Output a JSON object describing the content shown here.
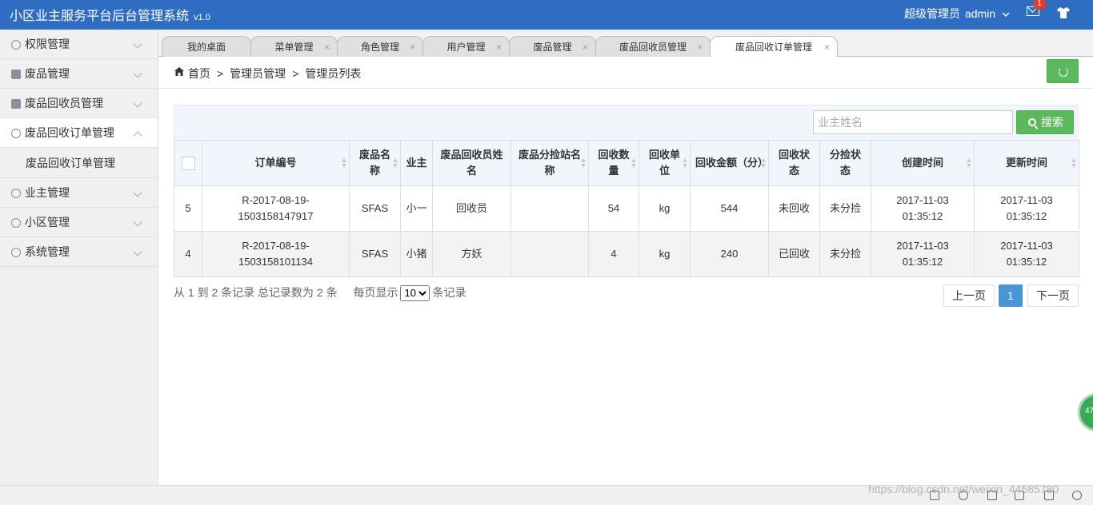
{
  "header": {
    "title": "小区业主服务平台后台管理系统",
    "version": "v1.0",
    "role": "超级管理员",
    "username": "admin",
    "mail_badge": "1"
  },
  "sidebar": {
    "items": [
      {
        "label": "权限管理"
      },
      {
        "label": "废品管理"
      },
      {
        "label": "废品回收员管理"
      },
      {
        "label": "废品回收订单管理"
      },
      {
        "label": "业主管理"
      },
      {
        "label": "小区管理"
      },
      {
        "label": "系统管理"
      }
    ],
    "sub_item": "废品回收订单管理"
  },
  "tabs": [
    {
      "label": "我的桌面"
    },
    {
      "label": "菜单管理"
    },
    {
      "label": "角色管理"
    },
    {
      "label": "用户管理"
    },
    {
      "label": "废品管理"
    },
    {
      "label": "废品回收员管理"
    },
    {
      "label": "废品回收订单管理"
    }
  ],
  "tab_close": "×",
  "breadcrumb": {
    "home": "首页",
    "level1": "管理员管理",
    "level2": "管理员列表",
    "sep": ">"
  },
  "search": {
    "placeholder": "业主姓名",
    "button": "搜索"
  },
  "table": {
    "headers": [
      "订单编号",
      "废品名称",
      "业主",
      "废品回收员姓名",
      "废品分捡站名称",
      "回收数量",
      "回收单位",
      "回收金额（分）",
      "回收状态",
      "分捡状态",
      "创建时间",
      "更新时间"
    ],
    "rows": [
      [
        "5",
        "R-2017-08-19-1503158147917",
        "SFAS",
        "小一",
        "回收员",
        "",
        "54",
        "kg",
        "544",
        "未回收",
        "未分捡",
        "2017-11-03 01:35:12",
        "2017-11-03 01:35:12"
      ],
      [
        "4",
        "R-2017-08-19-1503158101134",
        "SFAS",
        "小猪",
        "方妖",
        "",
        "4",
        "kg",
        "240",
        "已回收",
        "未分捡",
        "2017-11-03 01:35:12",
        "2017-11-03 01:35:12"
      ]
    ]
  },
  "footer": {
    "info": "从 1 到 2 条记录 总记录数为 2 条",
    "per_page_label": "每页显示",
    "per_page": "10",
    "per_page_suffix": "条记录",
    "prev": "上一页",
    "current_page": "1",
    "next": "下一页"
  },
  "watermark": "https://blog.csdn.net/weixin_44585780",
  "float_ball": "47",
  "colors": {
    "header_bg": "#2f6dc2",
    "button_green": "#5cb85c",
    "page_active": "#4a95d6",
    "badge_red": "#e03c31"
  }
}
